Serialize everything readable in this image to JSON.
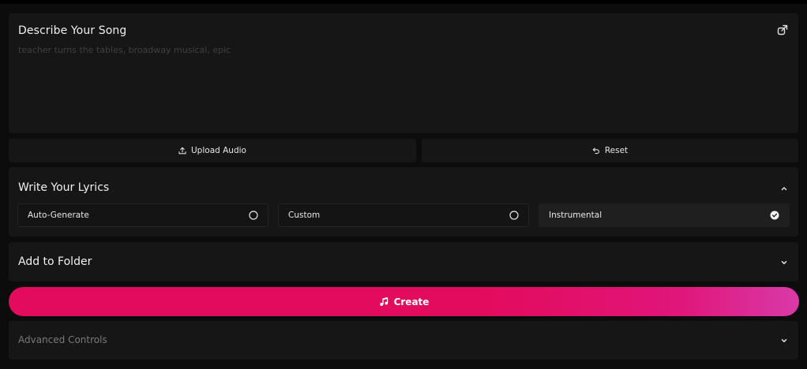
{
  "describe": {
    "title": "Describe Your Song",
    "placeholder": "teacher turns the tables, broadway musical, epic",
    "value": ""
  },
  "actions": {
    "upload_label": "Upload Audio",
    "reset_label": "Reset"
  },
  "lyrics": {
    "title": "Write Your Lyrics",
    "options": [
      {
        "label": "Auto-Generate",
        "selected": false
      },
      {
        "label": "Custom",
        "selected": false
      },
      {
        "label": "Instrumental",
        "selected": true
      }
    ]
  },
  "folder": {
    "title": "Add to Folder"
  },
  "create": {
    "label": "Create",
    "accent_color": "#e30b5d"
  },
  "advanced": {
    "title": "Advanced Controls"
  },
  "icons": {
    "open_external": "external-link-icon",
    "upload": "upload-icon",
    "reset": "undo-icon",
    "chevron_up": "chevron-up-icon",
    "chevron_down": "chevron-down-icon",
    "radio_empty": "radio-empty-icon",
    "radio_checked": "check-circle-icon",
    "music": "music-note-icon"
  }
}
